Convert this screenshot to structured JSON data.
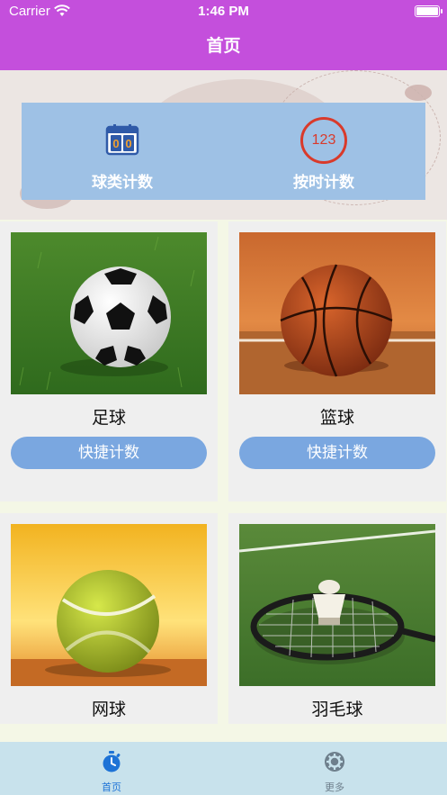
{
  "status_bar": {
    "carrier": "Carrier",
    "time": "1:46 PM"
  },
  "nav": {
    "title": "首页"
  },
  "counters": [
    {
      "label": "球类计数",
      "icon": "scoreboard-icon",
      "digits": "00"
    },
    {
      "label": "按时计数",
      "icon": "timer-123-icon",
      "digits": "123"
    }
  ],
  "sports": [
    {
      "name": "足球",
      "button": "快捷计数",
      "image": "soccer-ball-photo"
    },
    {
      "name": "篮球",
      "button": "快捷计数",
      "image": "basketball-photo"
    },
    {
      "name": "网球",
      "image": "tennis-ball-photo"
    },
    {
      "name": "羽毛球",
      "image": "badminton-photo"
    }
  ],
  "tabs": [
    {
      "label": "首页",
      "icon": "stopwatch-icon",
      "active": true
    },
    {
      "label": "更多",
      "icon": "gear-icon",
      "active": false
    }
  ],
  "colors": {
    "nav_bar": "#c44fdc",
    "counter_panel": "#9ec1e5",
    "button": "#7aa7e0",
    "tab_active": "#1e73d6",
    "tab_inactive": "#6e7f8c",
    "tab_bar": "#c8e2ec"
  }
}
